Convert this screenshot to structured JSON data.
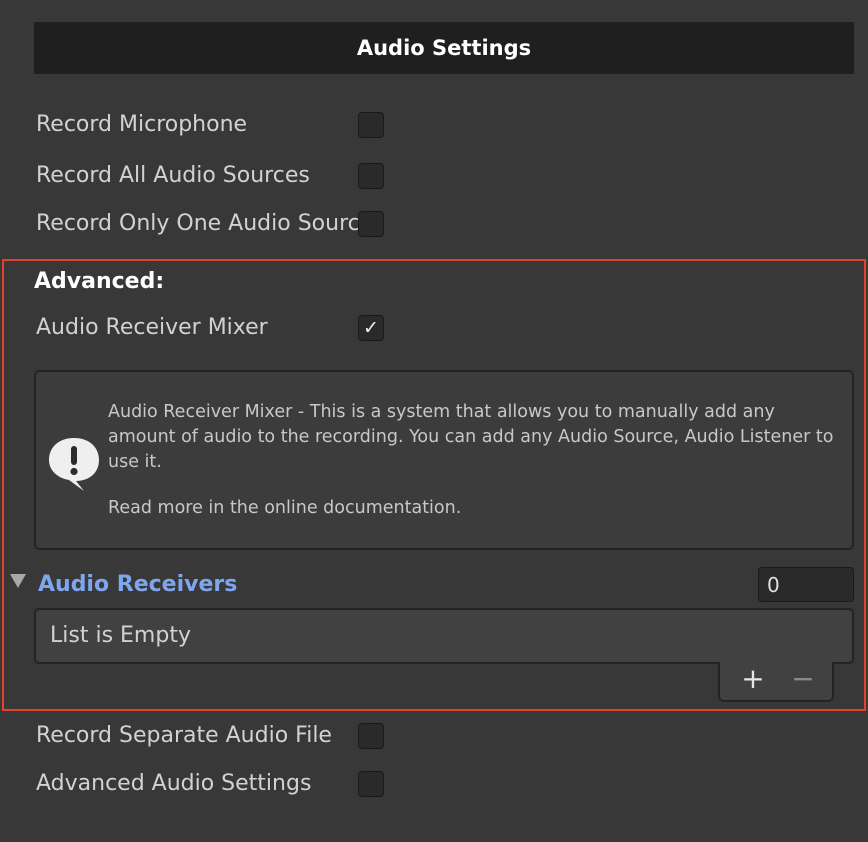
{
  "header": {
    "title": "Audio Settings"
  },
  "settings": [
    {
      "label": "Record Microphone",
      "checked": false
    },
    {
      "label": "Record All Audio Sources",
      "checked": false
    },
    {
      "label": "Record Only One Audio Source",
      "checked": false
    }
  ],
  "advanced": {
    "heading": "Advanced:",
    "mixer": {
      "label": "Audio Receiver Mixer",
      "checked": true,
      "checkmark": "✓"
    },
    "help": {
      "icon": "info-speech-bubble-icon",
      "text": "Audio Receiver Mixer - This is a system that allows you to manually add any amount of audio to the recording. You can add any Audio Source, Audio Listener to use it.",
      "link": "Read more in the online documentation."
    },
    "receivers": {
      "label": "Audio Receivers",
      "count": "0",
      "empty_text": "List is Empty",
      "add_label": "+",
      "remove_label": "−"
    },
    "frame_color": "#e0452b"
  },
  "footer_settings": [
    {
      "label": "Record Separate Audio File",
      "checked": false
    },
    {
      "label": "Advanced Audio Settings",
      "checked": false
    }
  ],
  "colors": {
    "background": "#383838",
    "header_background": "#1f1f1f",
    "foldout_label": "#7ea6ee"
  }
}
